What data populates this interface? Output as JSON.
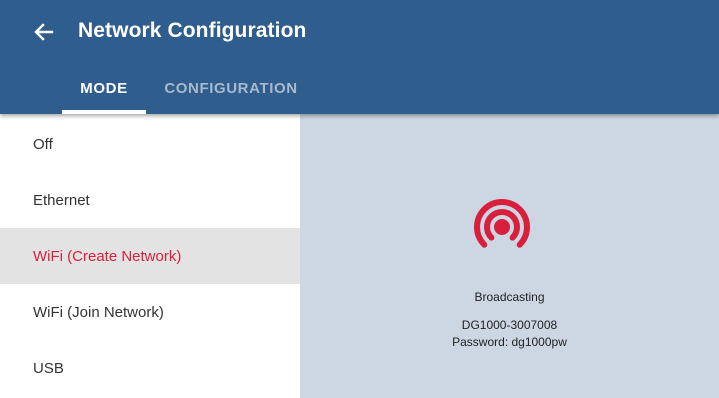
{
  "header": {
    "title": "Network Configuration",
    "back_icon": "arrow-left-icon",
    "background_color": "#2f5d8d"
  },
  "tabs": [
    {
      "label": "MODE",
      "active": true
    },
    {
      "label": "CONFIGURATION",
      "active": false
    }
  ],
  "modes": [
    {
      "label": "Off",
      "selected": false
    },
    {
      "label": "Ethernet",
      "selected": false
    },
    {
      "label": "WiFi (Create Network)",
      "selected": true
    },
    {
      "label": "WiFi (Join Network)",
      "selected": false
    },
    {
      "label": "USB",
      "selected": false
    }
  ],
  "status": {
    "icon": "broadcast-icon",
    "icon_color": "#d81f3c",
    "state": "Broadcasting",
    "network_name": "DG1000-3007008",
    "password_line": "Password: dg1000pw"
  },
  "colors": {
    "accent": "#d81f3c",
    "panel_background": "#cdd7e3",
    "selected_row": "#e3e3e3"
  }
}
